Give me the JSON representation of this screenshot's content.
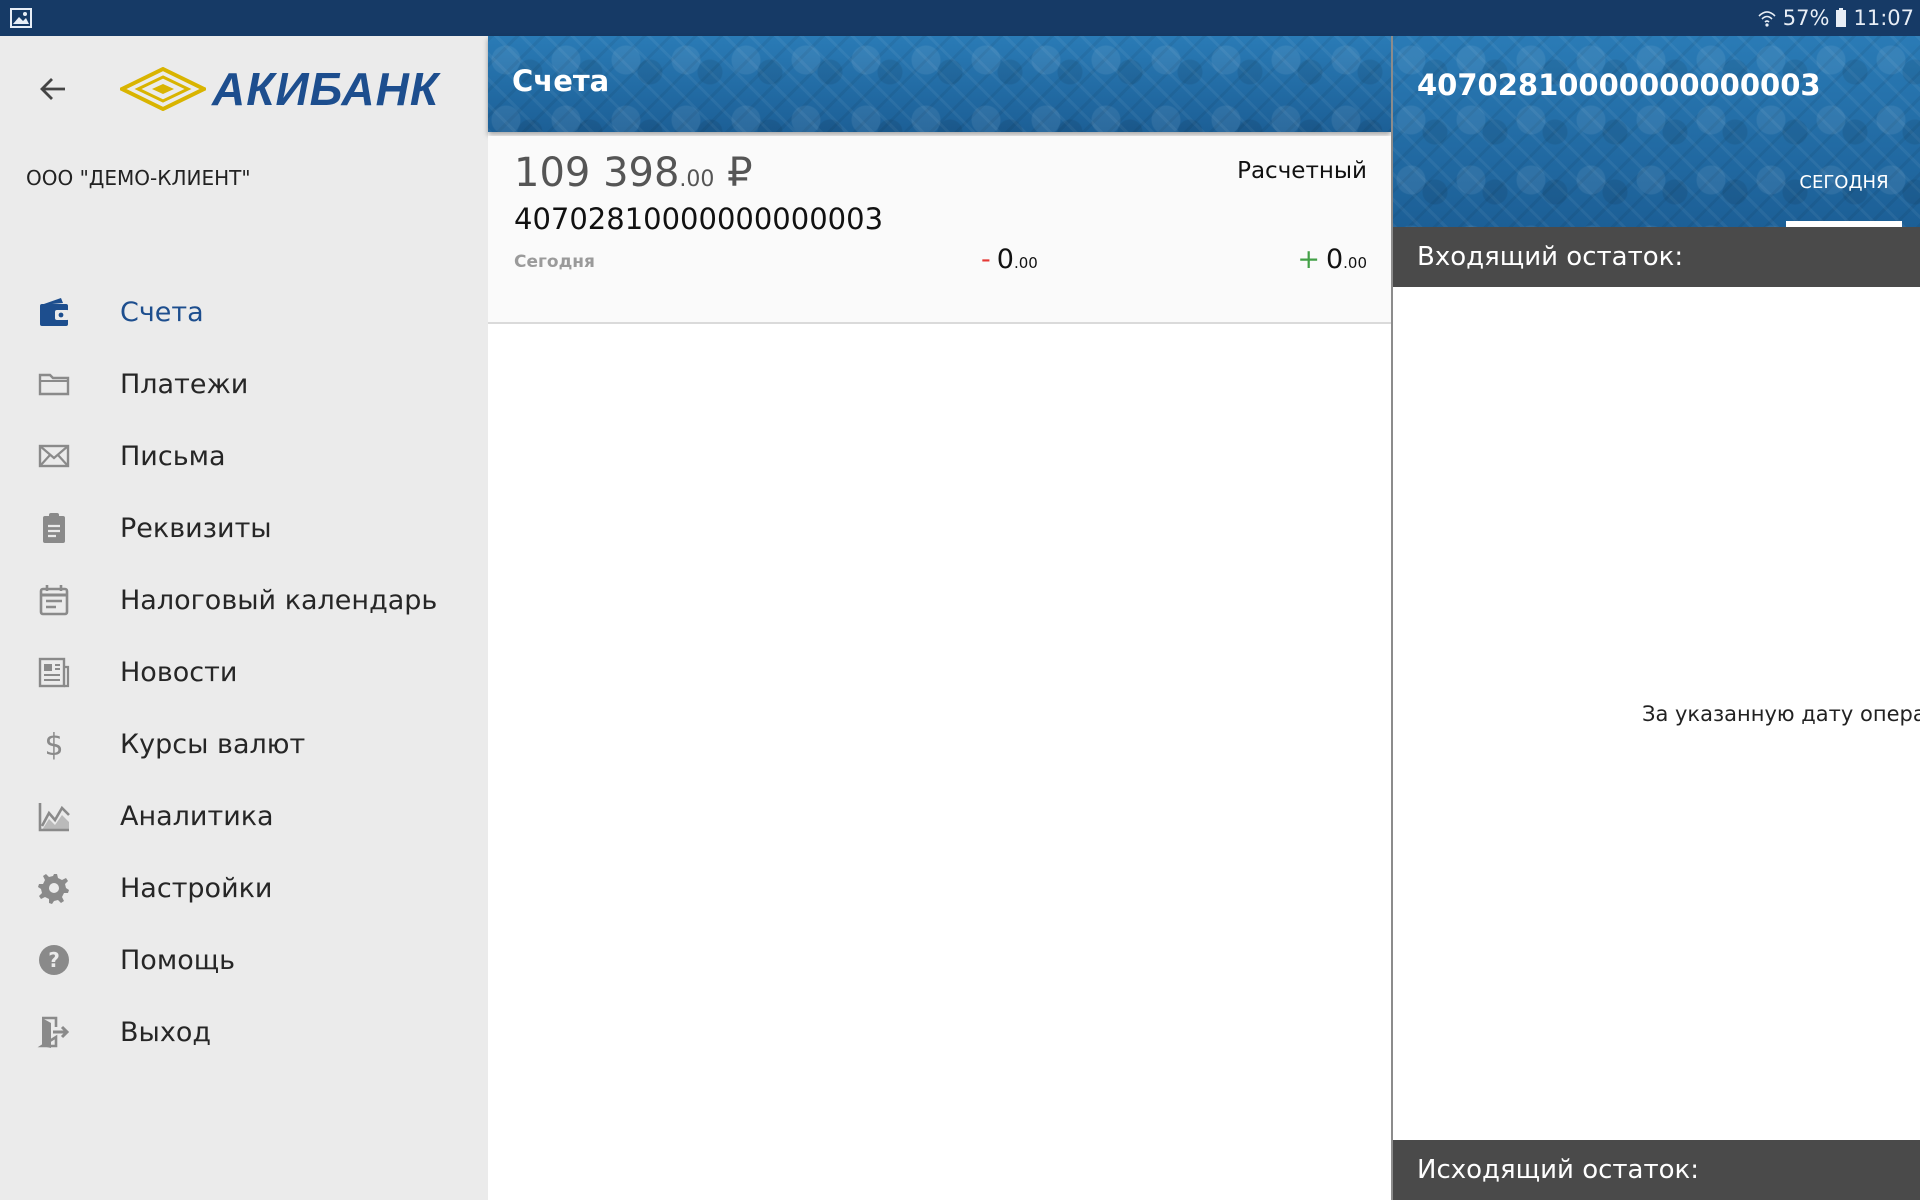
{
  "status_bar": {
    "battery_percent": "57%",
    "time": "11:07",
    "gallery_icon": "gallery-icon",
    "wifi_icon": "wifi-icon",
    "battery_icon": "battery-icon"
  },
  "sidebar": {
    "brand": "АКИБАНК",
    "client_name": "ООО \"ДЕМО-КЛИЕНТ\"",
    "items": [
      {
        "label": "Счета",
        "icon": "wallet-icon",
        "active": true
      },
      {
        "label": "Платежи",
        "icon": "folder-icon"
      },
      {
        "label": "Письма",
        "icon": "mail-icon"
      },
      {
        "label": "Реквизиты",
        "icon": "clipboard-icon"
      },
      {
        "label": "Налоговый календарь",
        "icon": "calendar-icon"
      },
      {
        "label": "Новости",
        "icon": "newspaper-icon"
      },
      {
        "label": "Курсы валют",
        "icon": "dollar-icon"
      },
      {
        "label": "Аналитика",
        "icon": "chart-icon"
      },
      {
        "label": "Настройки",
        "icon": "gear-icon"
      },
      {
        "label": "Помощь",
        "icon": "help-icon"
      },
      {
        "label": "Выход",
        "icon": "exit-icon"
      }
    ]
  },
  "accounts": {
    "title": "Счета",
    "list": [
      {
        "balance_int": "109 398",
        "balance_dec": ".00",
        "currency": "₽",
        "type": "Расчетный",
        "number": "40702810000000000003",
        "date_label": "Сегодня",
        "debit_sign": "-",
        "debit_int": "0",
        "debit_dec": ".00",
        "credit_sign": "+",
        "credit_int": "0",
        "credit_dec": ".00"
      }
    ]
  },
  "detail": {
    "account_number": "40702810000000000003",
    "tab_today": "СЕГОДНЯ",
    "incoming_label": "Входящий остаток:",
    "empty_message": "За указанную дату операции",
    "outgoing_label": "Исходящий остаток:"
  },
  "colors": {
    "status_bar": "#163a66",
    "brand_blue": "#1d4e8e",
    "header_blue": "#1f6aa3",
    "sidebar_bg": "#ebebeb",
    "summary_bar": "#4a4a4a",
    "debit_red": "#e53935",
    "credit_green": "#43a047",
    "logo_gold": "#d9b400"
  }
}
